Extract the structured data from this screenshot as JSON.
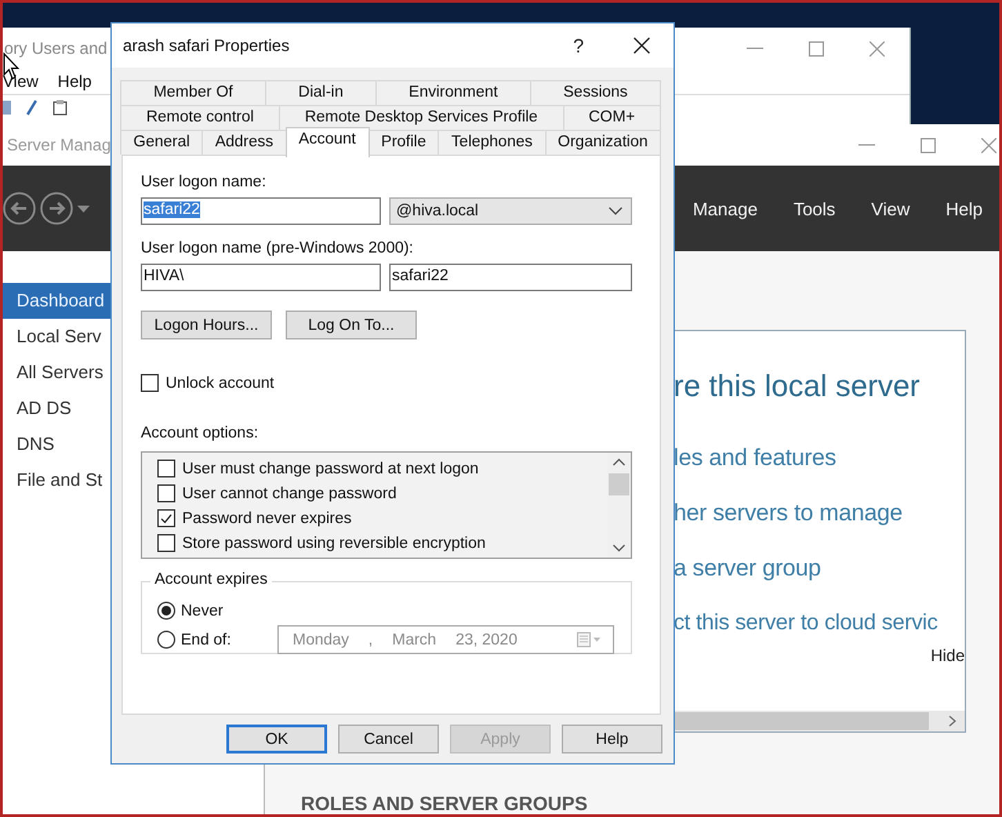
{
  "aduc_window": {
    "title": "ory Users and",
    "menu": [
      "View",
      "Help"
    ]
  },
  "server_manager": {
    "title": "Server Manag",
    "menu": [
      "Manage",
      "Tools",
      "View",
      "Help"
    ],
    "sidebar": {
      "items": [
        {
          "label": "Dashboard",
          "selected": true
        },
        {
          "label": "Local Serv",
          "selected": false
        },
        {
          "label": "All Servers",
          "selected": false
        },
        {
          "label": "AD DS",
          "selected": false
        },
        {
          "label": "DNS",
          "selected": false
        },
        {
          "label": "File and St",
          "selected": false
        }
      ]
    },
    "welcome": {
      "heading": "re this local server",
      "links": [
        "les and features",
        "her servers to manage",
        "a server group",
        "ct this server to cloud servic"
      ],
      "hide": "Hide"
    },
    "section_title": "ROLES AND SERVER GROUPS"
  },
  "dialog": {
    "title": "arash safari Properties",
    "help": "?",
    "tab_rows": [
      {
        "tabs": [
          {
            "label": "Member Of",
            "selected": false
          },
          {
            "label": "Dial-in",
            "selected": false
          },
          {
            "label": "Environment",
            "selected": false
          },
          {
            "label": "Sessions",
            "selected": false
          }
        ]
      },
      {
        "tabs": [
          {
            "label": "Remote control",
            "selected": false
          },
          {
            "label": "Remote Desktop Services Profile",
            "selected": false
          },
          {
            "label": "COM+",
            "selected": false
          }
        ]
      },
      {
        "tabs": [
          {
            "label": "General",
            "selected": false
          },
          {
            "label": "Address",
            "selected": false
          },
          {
            "label": "Account",
            "selected": true
          },
          {
            "label": "Profile",
            "selected": false
          },
          {
            "label": "Telephones",
            "selected": false
          },
          {
            "label": "Organization",
            "selected": false
          }
        ]
      }
    ],
    "logon_name": {
      "label": "User logon name:",
      "value": "safari22",
      "selected": true,
      "domain": "@hiva.local"
    },
    "pre2000": {
      "label": "User logon name (pre-Windows 2000):",
      "domain": "HIVA\\",
      "name": "safari22"
    },
    "mid_buttons": [
      "Logon Hours...",
      "Log On To..."
    ],
    "unlock": {
      "label": "Unlock account",
      "checked": false
    },
    "options": {
      "label": "Account options:",
      "items": [
        {
          "label": "User must change password at next logon",
          "checked": false
        },
        {
          "label": "User cannot change password",
          "checked": false
        },
        {
          "label": "Password never expires",
          "checked": true
        },
        {
          "label": "Store password using reversible encryption",
          "checked": false
        }
      ]
    },
    "expires": {
      "legend": "Account expires",
      "choices": [
        {
          "label": "Never",
          "selected": true
        },
        {
          "label": "End of:",
          "selected": false
        }
      ],
      "date": {
        "parts": [
          "Monday",
          ",",
          "March",
          "23, 2020"
        ],
        "disabled": true
      }
    },
    "buttons": [
      {
        "label": "OK",
        "default": true,
        "disabled": false
      },
      {
        "label": "Cancel",
        "default": false,
        "disabled": false
      },
      {
        "label": "Apply",
        "default": false,
        "disabled": true
      },
      {
        "label": "Help",
        "default": false,
        "disabled": false
      }
    ]
  }
}
